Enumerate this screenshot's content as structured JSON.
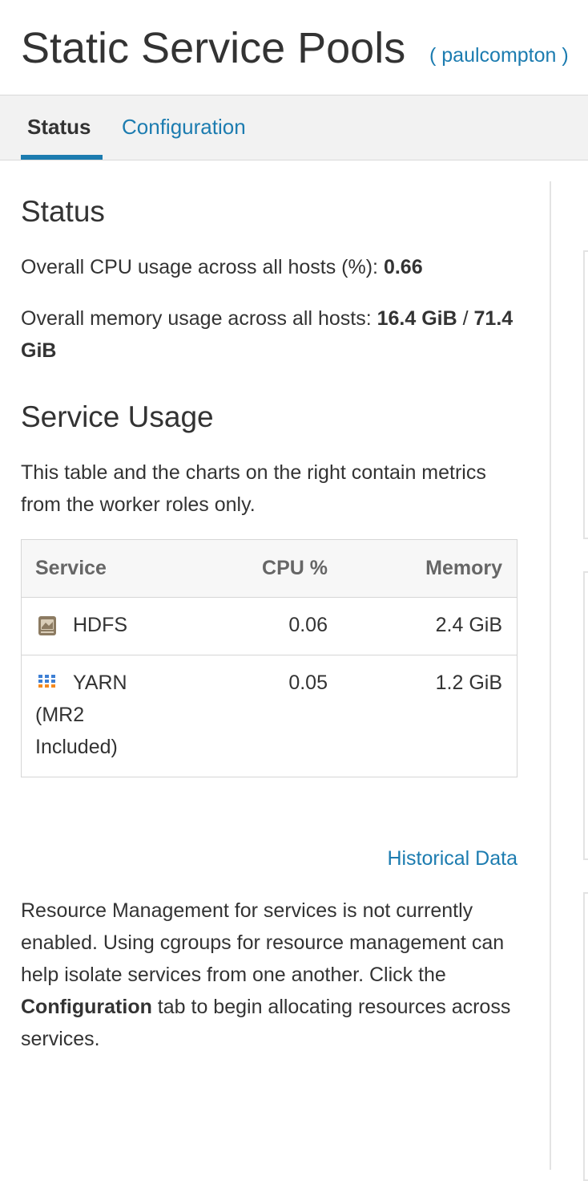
{
  "header": {
    "title": "Static Service Pools",
    "cluster_link": "( paulcompton )"
  },
  "tabs": [
    {
      "label": "Status",
      "active": true
    },
    {
      "label": "Configuration",
      "active": false
    }
  ],
  "status": {
    "heading": "Status",
    "cpu_label": "Overall CPU usage across all hosts (%): ",
    "cpu_value": "0.66",
    "memory_label": "Overall memory usage across all hosts: ",
    "memory_value": "16.4 GiB",
    "memory_sep": " / ",
    "memory_total": "71.4 GiB"
  },
  "service_usage": {
    "heading": "Service Usage",
    "description": "This table and the charts on the right contain metrics from the worker roles only.",
    "columns": [
      "Service",
      "CPU %",
      "Memory"
    ],
    "rows": [
      {
        "service": "HDFS",
        "cpu": "0.06",
        "memory": "2.4 GiB",
        "icon": "hdfs-icon"
      },
      {
        "service": "YARN (MR2 Included)",
        "cpu": "0.05",
        "memory": "1.2 GiB",
        "icon": "yarn-icon"
      }
    ],
    "historical_link": "Historical Data"
  },
  "resource_note": {
    "text_before": "Resource Management for services is not currently enabled. Using cgroups for resource management can help isolate services from one another. Click the ",
    "bold": "Configuration",
    "text_after": " tab to begin allocating resources across services."
  },
  "colors": {
    "link": "#1c7cb0",
    "text": "#333333",
    "tab_bar": "#f2f2f2"
  }
}
